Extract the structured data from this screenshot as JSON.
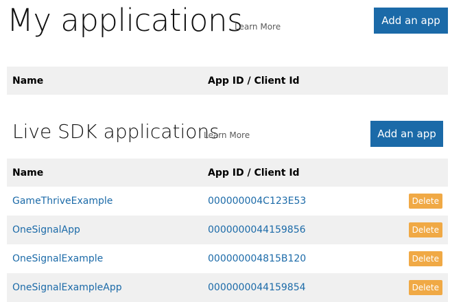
{
  "header": {
    "title": "My applications",
    "learn_more": "Learn More",
    "add_app": "Add an app"
  },
  "my_table": {
    "col_name": "Name",
    "col_appid": "App ID / Client Id"
  },
  "live": {
    "title": "Live SDK applications",
    "learn_more": "Learn More",
    "add_app": "Add an app",
    "col_name": "Name",
    "col_appid": "App ID / Client Id",
    "delete_label": "Delete",
    "rows": [
      {
        "name": "GameThriveExample",
        "app_id": "000000004C123E53"
      },
      {
        "name": "OneSignalApp",
        "app_id": "0000000044159856"
      },
      {
        "name": "OneSignalExample",
        "app_id": "000000004815B120"
      },
      {
        "name": "OneSignalExampleApp",
        "app_id": "0000000044159854"
      }
    ]
  },
  "colors": {
    "accent": "#1b6aa8",
    "delete": "#f0a945",
    "header_bg": "#f0f0f0"
  }
}
